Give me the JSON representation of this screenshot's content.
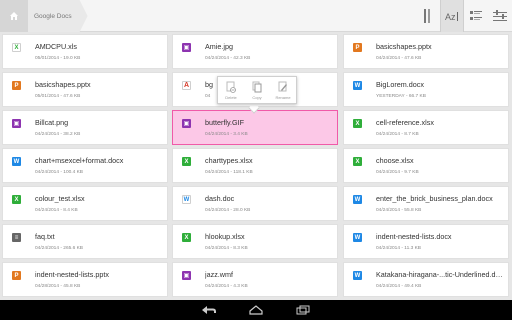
{
  "breadcrumb": {
    "home_icon": "home-icon",
    "current": "Google Docs"
  },
  "toolbar": {
    "icons": [
      "view-toggle-icon",
      "sort-az-icon",
      "details-view-icon",
      "filter-icon"
    ]
  },
  "context_menu": {
    "delete_label": "Delete",
    "copy_label": "Copy",
    "rename_label": "Rename"
  },
  "files": [
    {
      "name": "AMDCPU.xls",
      "meta": "05/01/2014 - 19.0 KB",
      "type": "xls-o",
      "icon_char": "X"
    },
    {
      "name": "Amie.jpg",
      "meta": "04/24/2014 - 42.3 KB",
      "type": "img",
      "icon_char": "▣"
    },
    {
      "name": "basicshapes.pptx",
      "meta": "04/24/2014 - 47.6 KB",
      "type": "ppt",
      "icon_char": "P"
    },
    {
      "name": "basicshapes.pptx",
      "meta": "05/01/2014 - 47.6 KB",
      "type": "ppt",
      "icon_char": "P"
    },
    {
      "name": "bg",
      "meta": "04",
      "type": "pdf",
      "icon_char": "A"
    },
    {
      "name": "BigLorem.docx",
      "meta": "YESTERDAY - 66.7 KB",
      "type": "doc",
      "icon_char": "W"
    },
    {
      "name": "Billcat.png",
      "meta": "04/24/2014 - 38.2 KB",
      "type": "img",
      "icon_char": "▣"
    },
    {
      "name": "butterfly.GIF",
      "meta": "04/24/2014 - 3.4 KB",
      "type": "img",
      "icon_char": "▣"
    },
    {
      "name": "cell-reference.xlsx",
      "meta": "04/24/2014 - 8.7 KB",
      "type": "xls-g",
      "icon_char": "X"
    },
    {
      "name": "chart+msexcel+format.docx",
      "meta": "04/24/2014 - 100.4 KB",
      "type": "doc",
      "icon_char": "W"
    },
    {
      "name": "charttypes.xlsx",
      "meta": "04/24/2014 - 118.1 KB",
      "type": "xls-g",
      "icon_char": "X"
    },
    {
      "name": "choose.xlsx",
      "meta": "04/24/2014 - 9.7 KB",
      "type": "xls-g",
      "icon_char": "X"
    },
    {
      "name": "colour_test.xlsx",
      "meta": "04/24/2014 - 8.4 KB",
      "type": "xls-g",
      "icon_char": "X"
    },
    {
      "name": "dash.doc",
      "meta": "04/24/2014 - 28.0 KB",
      "type": "doc-o",
      "icon_char": "W"
    },
    {
      "name": "enter_the_brick_business_plan.docx",
      "meta": "04/24/2014 - 55.8 KB",
      "type": "doc",
      "icon_char": "W"
    },
    {
      "name": "faq.txt",
      "meta": "04/24/2014 - 265.6 KB",
      "type": "txt",
      "icon_char": "≡"
    },
    {
      "name": "hlookup.xlsx",
      "meta": "04/24/2014 - 8.3 KB",
      "type": "xls-g",
      "icon_char": "X"
    },
    {
      "name": "indent-nested-lists.docx",
      "meta": "04/24/2014 - 11.3 KB",
      "type": "doc",
      "icon_char": "W"
    },
    {
      "name": "indent-nested-lists.pptx",
      "meta": "04/28/2014 - 45.8 KB",
      "type": "ppt",
      "icon_char": "P"
    },
    {
      "name": "jazz.wmf",
      "meta": "04/24/2014 - 4.3 KB",
      "type": "wmf",
      "icon_char": "▣"
    },
    {
      "name": "Katakana-hiragana-...tic-Underlined.docx",
      "meta": "04/24/2014 - 49.4 KB",
      "type": "doc",
      "icon_char": "W"
    }
  ],
  "navbar": {
    "back_icon": "back-icon",
    "home_icon": "nav-home-icon",
    "recents_icon": "recents-icon"
  }
}
